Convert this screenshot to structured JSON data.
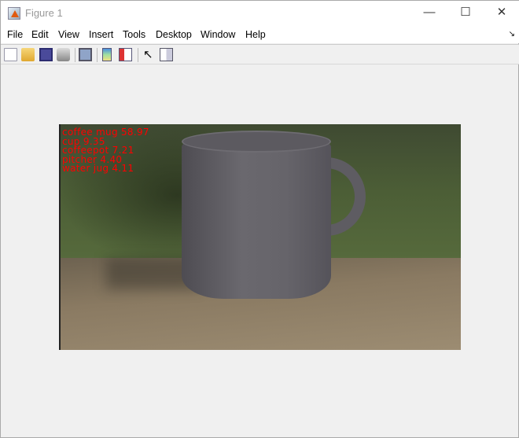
{
  "window": {
    "title": "Figure 1",
    "minimize": "—",
    "maximize": "☐",
    "close": "✕"
  },
  "menu": [
    "File",
    "Edit",
    "View",
    "Insert",
    "Tools",
    "Desktop",
    "Window",
    "Help"
  ],
  "toolbar": [
    "new-figure",
    "open-file",
    "save",
    "print",
    "link-plot",
    "insert-colorbar",
    "insert-legend",
    "edit-plot",
    "property-inspector"
  ],
  "image": {
    "predictions": [
      "coffee mug 58.97",
      "cup 9.35",
      "coffeepot 7.21",
      "pitcher 4.40",
      "water jug 4.11"
    ],
    "label_color": "#ff0000"
  }
}
